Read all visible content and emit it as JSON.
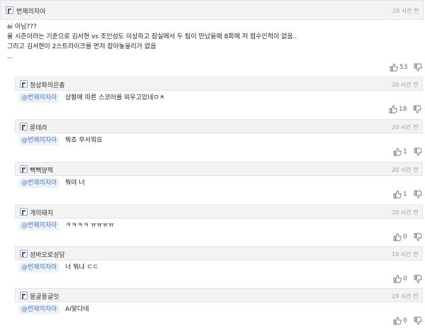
{
  "main_comment": {
    "nick": "번제의자아",
    "time": "20 시간 전",
    "lines": [
      "ai 아님???",
      "올 시즌이라는 기준으로 김서현 vs 조인성도 이상하고 잠실에서 두 팀이 만났을때 8회에 저 점수인적이 없음..",
      "그리고 김서현이 2스트라이크를 먼저 잡아놓을리가 없음",
      "..."
    ],
    "likes": "53"
  },
  "replies": [
    {
      "nick": "청상화의은총",
      "time": "20 시간 전",
      "mention": "@번제의자아",
      "text": "상황에 따른 스코어를 외우고있네ㅁㅊ",
      "likes": "18"
    },
    {
      "nick": "룬테라",
      "time": "20 시간 전",
      "mention": "@번제의자아",
      "text": "뭐죠 무서워요",
      "likes": "1"
    },
    {
      "nick": "뻑뻑양찍",
      "time": "20 시간 전",
      "mention": "@번제의자아",
      "text": "뭐야 너",
      "likes": "1"
    },
    {
      "nick": "개의돼지",
      "time": "20 시간 전",
      "mention": "@번제의자아",
      "text": "ㅋㅋㅋㅋ ㅠㅠㅠㅠ",
      "likes": "0"
    },
    {
      "nick": "성바오로성당",
      "time": "19 시간 전",
      "mention": "@번제의자아",
      "text": "너 뭐냐 ㄷㄷ",
      "likes": "0"
    },
    {
      "nick": "몽글몽글잇",
      "time": "19 시간 전",
      "mention": "@번제의자아",
      "text": "Ai맞다네",
      "likes": "0"
    }
  ],
  "icons": {
    "level": "level-badge-icon",
    "like": "thumbs-up-icon",
    "dislike": "thumbs-down-icon"
  },
  "colors": {
    "mention": "#4a78c4",
    "header_bg": "#f3f3f3"
  }
}
